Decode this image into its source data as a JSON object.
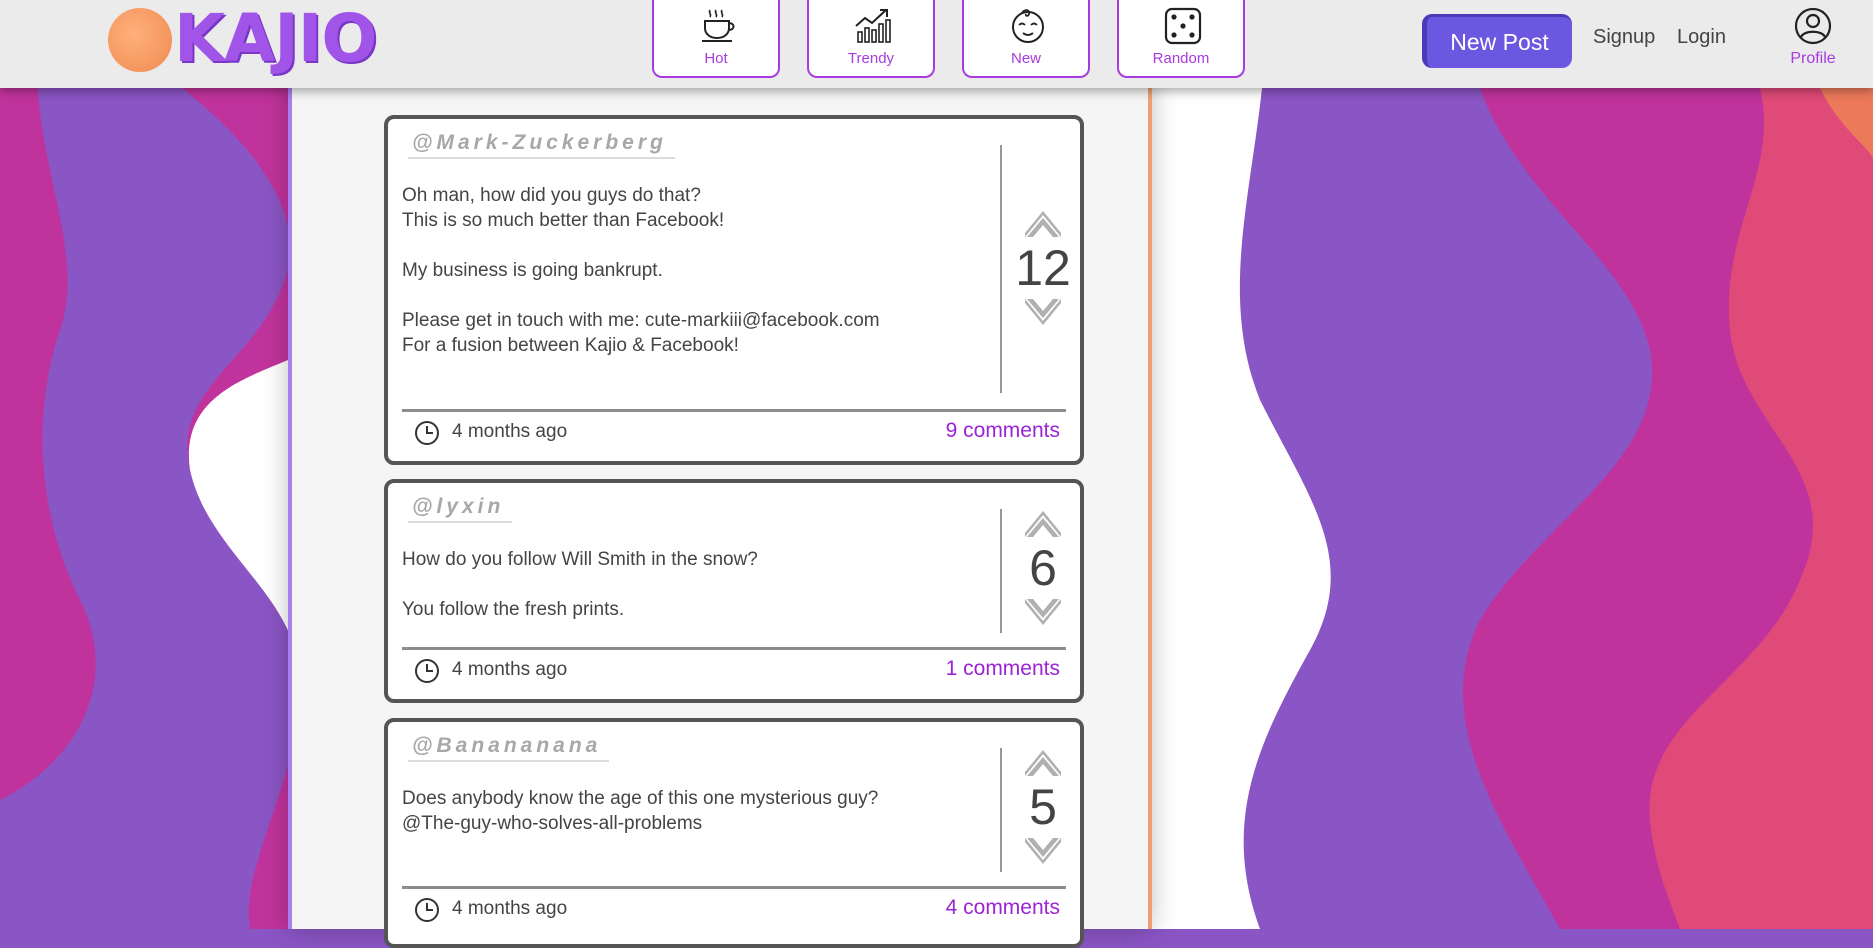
{
  "app": {
    "logo_text": "KAJIO"
  },
  "colors": {
    "accent_purple": "#a73be0",
    "new_post_bg": "#6b57e0",
    "comments_link": "#9b24d6",
    "card_border": "#555555"
  },
  "nav": {
    "tabs": [
      {
        "label": "Hot",
        "icon": "coffee-cup-icon"
      },
      {
        "label": "Trendy",
        "icon": "trending-chart-icon"
      },
      {
        "label": "New",
        "icon": "baby-face-icon"
      },
      {
        "label": "Random",
        "icon": "dice-icon"
      }
    ],
    "new_post_label": "New Post",
    "signup_label": "Signup",
    "login_label": "Login",
    "profile_label": "Profile",
    "profile_icon": "user-circle-icon"
  },
  "posts": [
    {
      "author": "@Mark-Zuckerberg",
      "paragraphs": [
        "Oh man, how did you guys do that?\nThis is so much better than Facebook!",
        "My business is going bankrupt.",
        "Please get in touch with me: cute-markiii@facebook.com\nFor a fusion between Kajio & Facebook!"
      ],
      "score": "12",
      "time": "4 months ago",
      "comments": "9 comments"
    },
    {
      "author": "@lyxin",
      "paragraphs": [
        "How do you follow Will Smith in the snow?",
        "You follow the fresh prints."
      ],
      "score": "6",
      "time": "4 months ago",
      "comments": "1 comments"
    },
    {
      "author": "@Banananana",
      "paragraphs": [
        "Does anybody know the age of this one mysterious guy?\n@The-guy-who-solves-all-problems"
      ],
      "score": "5",
      "time": "4 months ago",
      "comments": "4 comments"
    }
  ]
}
